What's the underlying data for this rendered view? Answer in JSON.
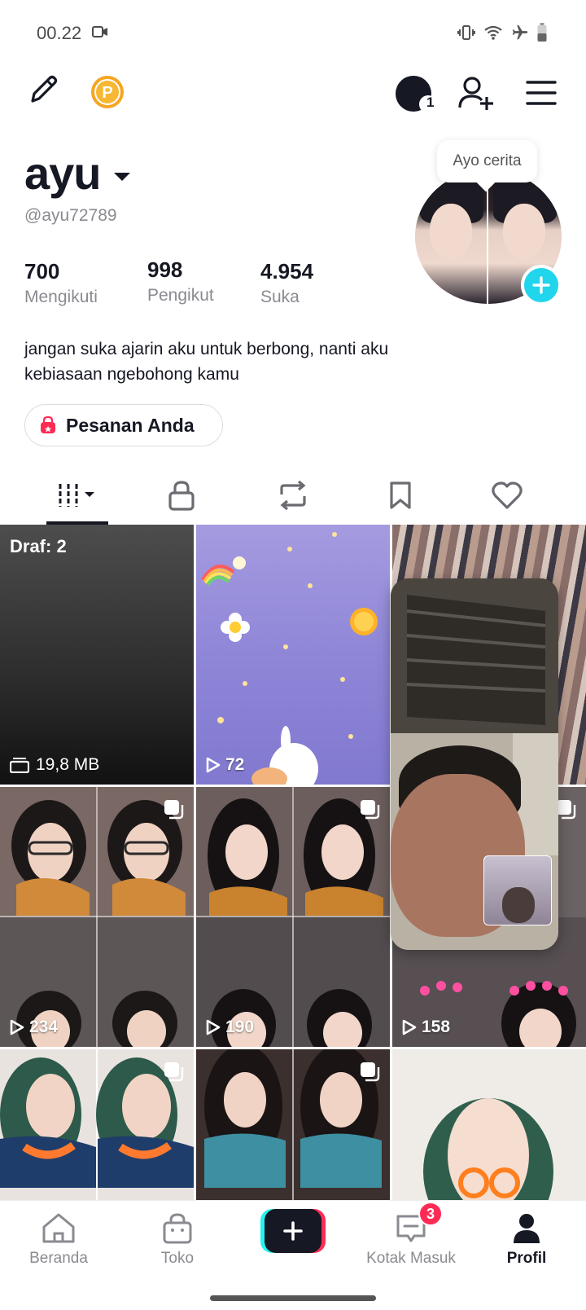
{
  "status_bar": {
    "time": "00.22"
  },
  "profile": {
    "username": "ayu",
    "handle": "@ayu72789",
    "story_bubble": "Ayo cerita",
    "stats": [
      {
        "value": "700",
        "label": "Mengikuti"
      },
      {
        "value": "998",
        "label": "Pengikut"
      },
      {
        "value": "4.954",
        "label": "Suka"
      }
    ],
    "bio_line1": "jangan suka ajarin aku untuk berbong, nanti aku",
    "bio_line2": "kebiasaan ngebohong kamu",
    "orders_button": "Pesanan Anda",
    "notification_count": "1"
  },
  "tabs": [
    "videos-tab",
    "private-tab",
    "reposts-tab",
    "favorites-tab",
    "liked-tab"
  ],
  "grid": {
    "draft": {
      "label": "Draf: 2",
      "size": "19,8 MB"
    },
    "views": [
      "72",
      "234",
      "190",
      "158"
    ]
  },
  "bottom_nav": {
    "home": "Beranda",
    "shop": "Toko",
    "inbox": "Kotak Masuk",
    "inbox_badge": "3",
    "profile": "Profil"
  },
  "colors": {
    "accent_cyan": "#20d5ec",
    "accent_red": "#fe2c55",
    "coin": "#f5a623",
    "text_dark": "#161823",
    "text_gray": "#8a8b91"
  }
}
